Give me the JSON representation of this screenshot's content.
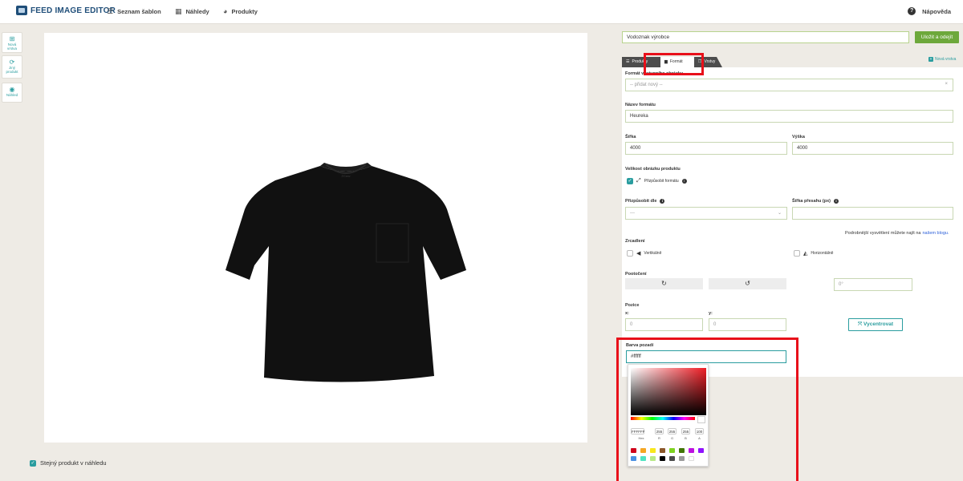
{
  "topbar": {
    "app_title": "FEED IMAGE EDITOR",
    "nav": [
      {
        "label": "Seznam šablon",
        "icon": "list-icon"
      },
      {
        "label": "Náhledy",
        "icon": "grid-icon"
      },
      {
        "label": "Produkty",
        "icon": "products-icon"
      }
    ],
    "help_label": "Nápověda"
  },
  "tools": [
    {
      "label_1": "Nová",
      "label_2": "vrstva",
      "icon": "plus-square-icon"
    },
    {
      "label_1": "Jiný",
      "label_2": "produkt",
      "icon": "refresh-icon"
    },
    {
      "label_1": "Náhled",
      "label_2": "",
      "icon": "eye-icon"
    }
  ],
  "preview": {
    "same_product_label": "Stejný produkt v náhledu",
    "same_product_checked": true
  },
  "editor": {
    "template_name": "Vodoznak výrobce",
    "save_label": "Uložit a odejít",
    "tabs": [
      {
        "label": "Produkty",
        "icon": "list-icon",
        "active": false
      },
      {
        "label": "Formát",
        "icon": "format-icon",
        "active": true
      },
      {
        "label": "Vrstvy",
        "icon": "layers-icon",
        "active": false
      }
    ],
    "new_layer_label": "Nová vrstva"
  },
  "form": {
    "format_select_label": "Formát výstupního obrázku",
    "format_select_value": "-- přidat nový --",
    "format_name_label": "Název formátu",
    "format_name_value": "Heureka",
    "width_label": "Šířka",
    "width_value": "4000",
    "height_label": "Výška",
    "height_value": "4000",
    "product_size_label": "Velikost obrázku produktu",
    "fit_format_label": "Přizpůsobit formátu",
    "fit_format_checked": true,
    "fit_by_label": "Přizpůsobit dle",
    "fit_by_value": "---",
    "overflow_width_label": "Šířka přesahu (px)",
    "overflow_width_value": "",
    "blog_note": "Podrobnější vysvětlení můžete najít na",
    "blog_link": "našem blogu.",
    "mirror_label": "Zrcadlení",
    "mirror_vertical_label": "Vertikálně",
    "mirror_horizontal_label": "Horizontálně",
    "rotation_label": "Pootočení",
    "rotation_value": "0°",
    "position_label": "Pozice",
    "x_label": "x:",
    "x_value": "0",
    "y_label": "y:",
    "y_value": "0",
    "center_label": "Vycentrovat",
    "bg_color_label": "Barva pozadí",
    "bg_color_value": "#ffffff"
  },
  "color_picker": {
    "hex_value": "FFFFFF",
    "r_value": "255",
    "g_value": "255",
    "b_value": "255",
    "a_value": "100",
    "hex_label": "Hex",
    "r_label": "R",
    "g_label": "G",
    "b_label": "B",
    "a_label": "A",
    "swatches": [
      "#d0021b",
      "#f5a623",
      "#f8e71c",
      "#8b572a",
      "#7ed321",
      "#417505",
      "#bd10e0",
      "#9013fe",
      "#4a90e2",
      "#50e3c2",
      "#b8e986",
      "#000000",
      "#4a4a4a",
      "#9b9b9b",
      "#ffffff"
    ]
  },
  "colors": {
    "accent": "#2a9d9f",
    "save_green": "#6da83b",
    "brand_blue": "#1f4e79",
    "highlight_red": "#e8101a"
  }
}
